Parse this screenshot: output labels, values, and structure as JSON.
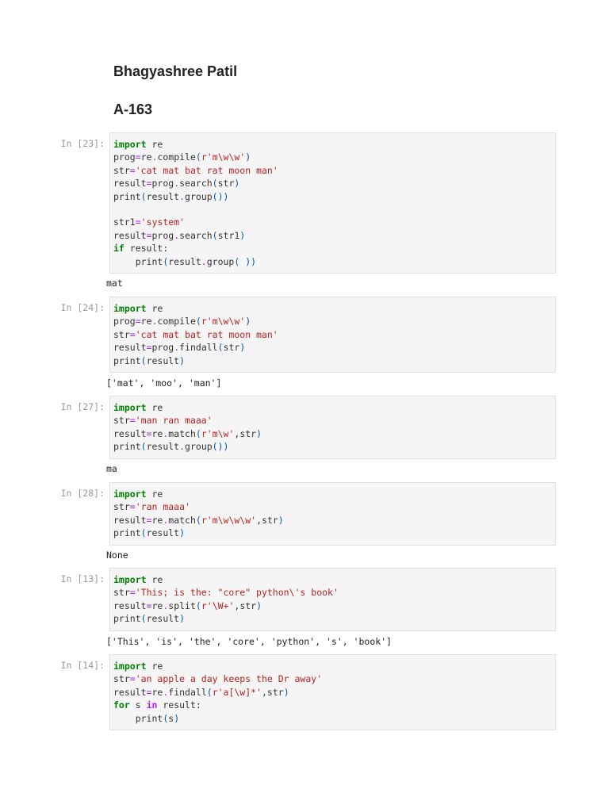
{
  "header": {
    "name": "Bhagyashree Patil",
    "roll": "A-163"
  },
  "cells": [
    {
      "prompt": "In [23]:",
      "output": "mat",
      "lines": [
        [
          [
            "k",
            "import"
          ],
          [
            "n",
            " re"
          ]
        ],
        [
          [
            "n",
            "prog"
          ],
          [
            "o",
            "="
          ],
          [
            "n",
            "re"
          ],
          [
            "o",
            "."
          ],
          [
            "n",
            "compile"
          ],
          [
            "p",
            "("
          ],
          [
            "s",
            "r'm\\w\\w'"
          ],
          [
            "p",
            ")"
          ]
        ],
        [
          [
            "n",
            "str"
          ],
          [
            "o",
            "="
          ],
          [
            "s",
            "'cat mat bat rat moon man'"
          ]
        ],
        [
          [
            "n",
            "result"
          ],
          [
            "o",
            "="
          ],
          [
            "n",
            "prog"
          ],
          [
            "o",
            "."
          ],
          [
            "n",
            "search"
          ],
          [
            "p",
            "("
          ],
          [
            "n",
            "str"
          ],
          [
            "p",
            ")"
          ]
        ],
        [
          [
            "n",
            "print"
          ],
          [
            "p",
            "("
          ],
          [
            "n",
            "result"
          ],
          [
            "o",
            "."
          ],
          [
            "n",
            "group"
          ],
          [
            "p",
            "())"
          ]
        ],
        [],
        [
          [
            "n",
            "str1"
          ],
          [
            "o",
            "="
          ],
          [
            "s",
            "'system'"
          ]
        ],
        [
          [
            "n",
            "result"
          ],
          [
            "o",
            "="
          ],
          [
            "n",
            "prog"
          ],
          [
            "o",
            "."
          ],
          [
            "n",
            "search"
          ],
          [
            "p",
            "("
          ],
          [
            "n",
            "str1"
          ],
          [
            "p",
            ")"
          ]
        ],
        [
          [
            "k",
            "if"
          ],
          [
            "n",
            " result:"
          ]
        ],
        [
          [
            "n",
            "    print"
          ],
          [
            "p",
            "("
          ],
          [
            "n",
            "result"
          ],
          [
            "o",
            "."
          ],
          [
            "n",
            "group"
          ],
          [
            "p",
            "( ))"
          ]
        ]
      ]
    },
    {
      "prompt": "In [24]:",
      "output": "['mat', 'moo', 'man']",
      "lines": [
        [
          [
            "k",
            "import"
          ],
          [
            "n",
            " re"
          ]
        ],
        [
          [
            "n",
            "prog"
          ],
          [
            "o",
            "="
          ],
          [
            "n",
            "re"
          ],
          [
            "o",
            "."
          ],
          [
            "n",
            "compile"
          ],
          [
            "p",
            "("
          ],
          [
            "s",
            "r'm\\w\\w'"
          ],
          [
            "p",
            ")"
          ]
        ],
        [
          [
            "n",
            "str"
          ],
          [
            "o",
            "="
          ],
          [
            "s",
            "'cat mat bat rat moon man'"
          ]
        ],
        [
          [
            "n",
            "result"
          ],
          [
            "o",
            "="
          ],
          [
            "n",
            "prog"
          ],
          [
            "o",
            "."
          ],
          [
            "n",
            "findall"
          ],
          [
            "p",
            "("
          ],
          [
            "n",
            "str"
          ],
          [
            "p",
            ")"
          ]
        ],
        [
          [
            "n",
            "print"
          ],
          [
            "p",
            "("
          ],
          [
            "n",
            "result"
          ],
          [
            "p",
            ")"
          ]
        ]
      ]
    },
    {
      "prompt": "In [27]:",
      "output": "ma",
      "lines": [
        [
          [
            "k",
            "import"
          ],
          [
            "n",
            " re"
          ]
        ],
        [
          [
            "n",
            "str"
          ],
          [
            "o",
            "="
          ],
          [
            "s",
            "'man ran maaa'"
          ]
        ],
        [
          [
            "n",
            "result"
          ],
          [
            "o",
            "="
          ],
          [
            "n",
            "re"
          ],
          [
            "o",
            "."
          ],
          [
            "n",
            "match"
          ],
          [
            "p",
            "("
          ],
          [
            "s",
            "r'm\\w'"
          ],
          [
            "n",
            ",str"
          ],
          [
            "p",
            ")"
          ]
        ],
        [
          [
            "n",
            "print"
          ],
          [
            "p",
            "("
          ],
          [
            "n",
            "result"
          ],
          [
            "o",
            "."
          ],
          [
            "n",
            "group"
          ],
          [
            "p",
            "())"
          ]
        ]
      ]
    },
    {
      "prompt": "In [28]:",
      "output": "None",
      "lines": [
        [
          [
            "k",
            "import"
          ],
          [
            "n",
            " re"
          ]
        ],
        [
          [
            "n",
            "str"
          ],
          [
            "o",
            "="
          ],
          [
            "s",
            "'ran maaa'"
          ]
        ],
        [
          [
            "n",
            "result"
          ],
          [
            "o",
            "="
          ],
          [
            "n",
            "re"
          ],
          [
            "o",
            "."
          ],
          [
            "n",
            "match"
          ],
          [
            "p",
            "("
          ],
          [
            "s",
            "r'm\\w\\w\\w'"
          ],
          [
            "n",
            ",str"
          ],
          [
            "p",
            ")"
          ]
        ],
        [
          [
            "n",
            "print"
          ],
          [
            "p",
            "("
          ],
          [
            "n",
            "result"
          ],
          [
            "p",
            ")"
          ]
        ]
      ]
    },
    {
      "prompt": "In [13]:",
      "output": "['This', 'is', 'the', 'core', 'python', 's', 'book']",
      "lines": [
        [
          [
            "k",
            "import"
          ],
          [
            "n",
            " re"
          ]
        ],
        [
          [
            "n",
            "str"
          ],
          [
            "o",
            "="
          ],
          [
            "s",
            "'This; is the: \"core\" python\\'s book'"
          ]
        ],
        [
          [
            "n",
            "result"
          ],
          [
            "o",
            "="
          ],
          [
            "n",
            "re"
          ],
          [
            "o",
            "."
          ],
          [
            "n",
            "split"
          ],
          [
            "p",
            "("
          ],
          [
            "s",
            "r'\\W+'"
          ],
          [
            "n",
            ",str"
          ],
          [
            "p",
            ")"
          ]
        ],
        [
          [
            "n",
            "print"
          ],
          [
            "p",
            "("
          ],
          [
            "n",
            "result"
          ],
          [
            "p",
            ")"
          ]
        ]
      ]
    },
    {
      "prompt": "In [14]:",
      "output": null,
      "lines": [
        [
          [
            "k",
            "import"
          ],
          [
            "n",
            " re"
          ]
        ],
        [
          [
            "n",
            "str"
          ],
          [
            "o",
            "="
          ],
          [
            "s",
            "'an apple a day keeps the Dr away'"
          ]
        ],
        [
          [
            "n",
            "result"
          ],
          [
            "o",
            "="
          ],
          [
            "n",
            "re"
          ],
          [
            "o",
            "."
          ],
          [
            "n",
            "findall"
          ],
          [
            "p",
            "("
          ],
          [
            "s",
            "r'a[\\w]*'"
          ],
          [
            "n",
            ",str"
          ],
          [
            "p",
            ")"
          ]
        ],
        [
          [
            "k",
            "for"
          ],
          [
            "n",
            " s "
          ],
          [
            "kp",
            "in"
          ],
          [
            "n",
            " result:"
          ]
        ],
        [
          [
            "n",
            "    print"
          ],
          [
            "p",
            "("
          ],
          [
            "n",
            "s"
          ],
          [
            "p",
            ")"
          ]
        ]
      ]
    }
  ]
}
